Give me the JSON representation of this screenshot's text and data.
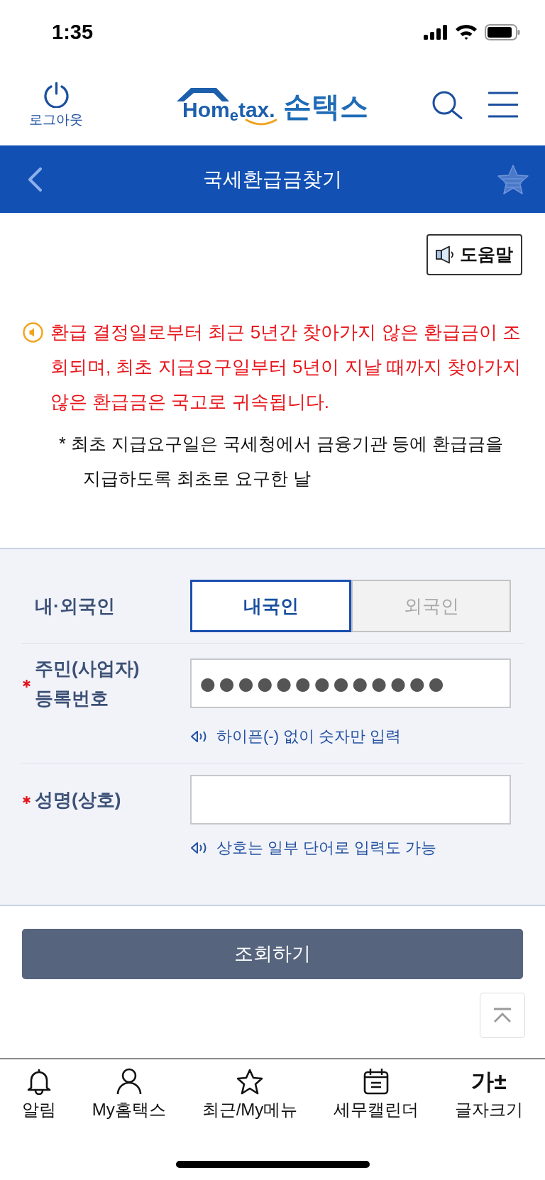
{
  "status_bar": {
    "time": "1:35"
  },
  "header": {
    "logout_label": "로그아웃",
    "logo": {
      "wordmark": "Hom$_{e}$tax.",
      "title": "손택스"
    }
  },
  "title_bar": {
    "title": "국세환급금찾기",
    "starred": false
  },
  "help_button": {
    "label": "도움말"
  },
  "notice": {
    "text": "환급 결정일로부터 최근 5년간 찾아가지 않은 환급금이 조회되며, 최초 지급요구일부터 5년이 지날 때까지 찾아가지 않은 환급금은 국고로 귀속됩니다."
  },
  "footnote": "* 최초 지급요구일은 국세청에서 금융기관 등에 환급금을 지급하도록 최초로 요구한 날",
  "form": {
    "rows": [
      {
        "kind": "segmented",
        "label": "내·외국인",
        "required": false,
        "options": [
          {
            "label": "내국인",
            "selected": true
          },
          {
            "label": "외국인",
            "selected": false
          }
        ]
      },
      {
        "kind": "input",
        "label": "주민(사업자) 등록번호",
        "required": true,
        "value": "●●●●●●●●●●●●●",
        "hint": "하이픈(-) 없이 숫자만 입력"
      },
      {
        "kind": "input",
        "label": "성명(상호)",
        "required": true,
        "hint": "상호는 일부 단어로 입력도 가능"
      }
    ]
  },
  "submit_button": {
    "label": "조회하기"
  },
  "bottom_nav": [
    {
      "kind": "icon",
      "label": "알림"
    },
    {
      "kind": "icon",
      "label": "My홈택스"
    },
    {
      "kind": "icon",
      "label": "최근/My메뉴"
    },
    {
      "kind": "icon",
      "label": "세무캘린더"
    },
    {
      "kind": "glyph",
      "glyph": "가±",
      "label": "글자크기"
    }
  ]
}
